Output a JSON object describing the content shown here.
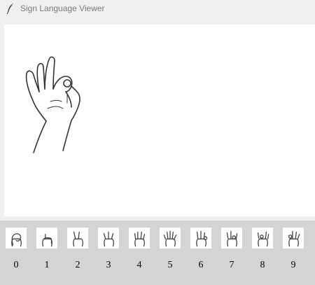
{
  "window": {
    "title": "Sign Language Viewer",
    "icon": "feather-icon"
  },
  "viewer": {
    "displayed_sign": "9",
    "image": "hand-sign-nine-ok-icon"
  },
  "signs": [
    {
      "label": "0",
      "icon": "hand-sign-0-icon"
    },
    {
      "label": "1",
      "icon": "hand-sign-1-icon"
    },
    {
      "label": "2",
      "icon": "hand-sign-2-icon"
    },
    {
      "label": "3",
      "icon": "hand-sign-3-icon"
    },
    {
      "label": "4",
      "icon": "hand-sign-4-icon"
    },
    {
      "label": "5",
      "icon": "hand-sign-5-icon"
    },
    {
      "label": "6",
      "icon": "hand-sign-6-icon"
    },
    {
      "label": "7",
      "icon": "hand-sign-7-icon"
    },
    {
      "label": "8",
      "icon": "hand-sign-8-icon"
    },
    {
      "label": "9",
      "icon": "hand-sign-9-icon"
    }
  ],
  "colors": {
    "window_bg": "#f0f0f0",
    "canvas_bg": "#ffffff",
    "strip_bg": "#d4d4d4",
    "title_text": "#7a7a7a"
  }
}
